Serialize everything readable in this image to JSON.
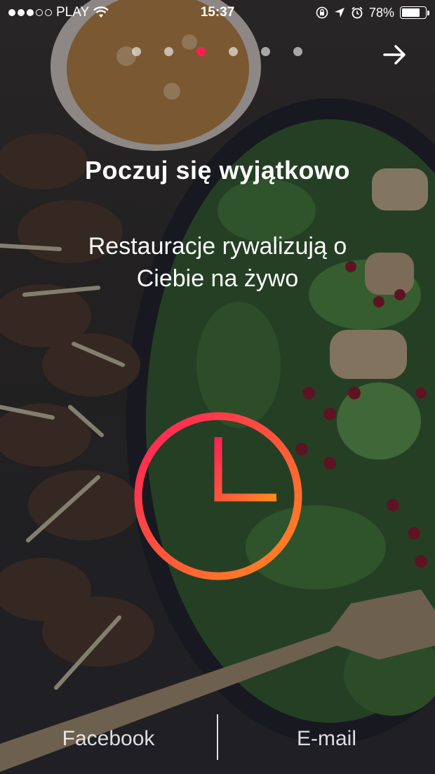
{
  "status_bar": {
    "carrier": "PLAY",
    "time": "15:37",
    "battery": "78%",
    "battery_level": 0.78,
    "signal_bars_filled": 3,
    "signal_bars_total": 5
  },
  "pager": {
    "count": 6,
    "active_index": 2,
    "active_color": "#ff1f4f"
  },
  "onboarding": {
    "title": "Poczuj się wyjątkowo",
    "subtitle": "Restauracje rywalizują o Ciebie na żywo"
  },
  "icons": {
    "next": "arrow-right-icon",
    "main": "clock-icon",
    "clock_gradient": [
      "#ff1f5a",
      "#ff8a1e"
    ]
  },
  "bottom_bar": {
    "facebook_label": "Facebook",
    "email_label": "E-mail"
  }
}
